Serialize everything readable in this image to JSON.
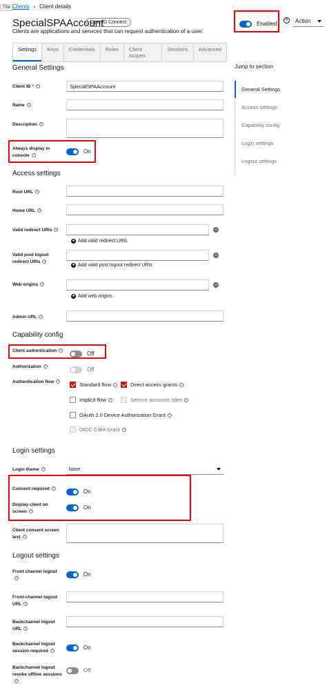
{
  "tooltip": "Title",
  "breadcrumb": {
    "clients": "Clients",
    "separator": "›",
    "current": "Client details"
  },
  "header": {
    "title": "SpecialSPAAccount",
    "badge": "OpenID Connect",
    "subtitle": "Clients are applications and services that can request authentication of a user.",
    "enabled_label": "Enabled",
    "action_label": "Action"
  },
  "tabs": [
    "Settings",
    "Keys",
    "Credentials",
    "Roles",
    "Client scopes",
    "Sessions",
    "Advanced"
  ],
  "jump": {
    "title": "Jump to section",
    "items": [
      "General Settings",
      "Access settings",
      "Capability config",
      "Login settings",
      "Logout settings"
    ]
  },
  "general": {
    "title": "General Settings",
    "client_id_label": "Client ID",
    "client_id_value": "SpecialSPAAccount",
    "name_label": "Name",
    "description_label": "Description",
    "always_display_label": "Always display in console",
    "always_display_state": "On"
  },
  "access": {
    "title": "Access settings",
    "root_url_label": "Root URL",
    "home_url_label": "Home URL",
    "valid_redirect_label": "Valid redirect URIs",
    "add_redirect": "Add valid redirect URIs",
    "valid_post_logout_label": "Valid post logout redirect URIs",
    "add_post_logout": "Add valid post logout redirect URIs",
    "web_origins_label": "Web origins",
    "add_web_origins": "Add web origins",
    "admin_url_label": "Admin URL"
  },
  "capability": {
    "title": "Capability config",
    "client_auth_label": "Client authentication",
    "client_auth_state": "Off",
    "authorization_label": "Authorization",
    "authorization_state": "Off",
    "auth_flow_label": "Authentication flow",
    "flows": {
      "standard": "Standard flow",
      "direct": "Direct access grants",
      "implicit": "Implicit flow",
      "service": "Service accounts roles",
      "device": "OAuth 2.0 Device Authorization Grant",
      "ciba": "OIDC CIBA Grant"
    }
  },
  "login": {
    "title": "Login settings",
    "theme_label": "Login theme",
    "theme_value": "base",
    "consent_label": "Consent required",
    "consent_state": "On",
    "display_client_label": "Display client on screen",
    "display_client_state": "On",
    "consent_text_label": "Client consent screen text"
  },
  "logout": {
    "title": "Logout settings",
    "front_channel_label": "Front channel logout",
    "front_channel_state": "On",
    "front_channel_url_label": "Front-channel logout URL",
    "backchannel_url_label": "Backchannel logout URL",
    "backchannel_session_label": "Backchannel logout session required",
    "backchannel_session_state": "On",
    "backchannel_revoke_label": "Backchannel logout revoke offline sessions",
    "backchannel_revoke_state": "Off"
  },
  "colors": {
    "accent": "#0066cc",
    "highlight": "#ee0000",
    "checked": "#c9190b"
  }
}
